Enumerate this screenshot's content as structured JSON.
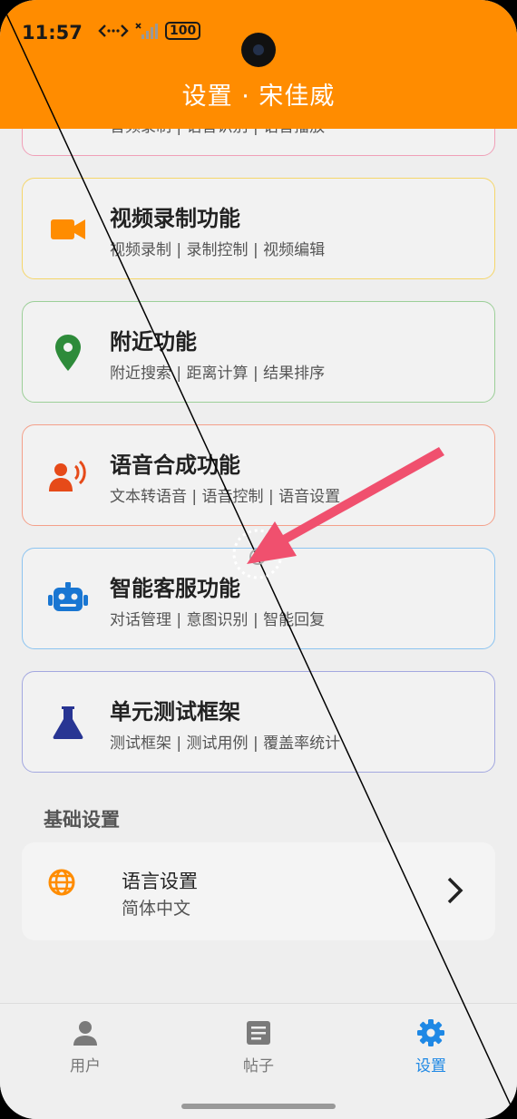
{
  "status": {
    "time": "11:57",
    "battery": "100"
  },
  "header": {
    "title": "设置 · 宋佳威"
  },
  "partial_card": {
    "subtitle": "音频录制 | 语音识别 | 语音播放"
  },
  "cards": [
    {
      "title": "视频录制功能",
      "subtitle": "视频录制 | 录制控制 | 视频编辑",
      "icon": "video-camera-icon",
      "color": "#ff8c00",
      "border": "#f5d66a"
    },
    {
      "title": "附近功能",
      "subtitle": "附近搜索 | 距离计算 | 结果排序",
      "icon": "location-pin-icon",
      "color": "#2e8b3a",
      "border": "#9ccf98"
    },
    {
      "title": "语音合成功能",
      "subtitle": "文本转语音 | 语音控制 | 语音设置",
      "icon": "voice-speaker-icon",
      "color": "#e64a19",
      "border": "#f4a08a"
    },
    {
      "title": "智能客服功能",
      "subtitle": "对话管理 | 意图识别 | 智能回复",
      "icon": "robot-icon",
      "color": "#1976d2",
      "border": "#8cc4f0"
    },
    {
      "title": "单元测试框架",
      "subtitle": "测试框架 | 测试用例 | 覆盖率统计",
      "icon": "flask-icon",
      "color": "#283593",
      "border": "#a3a8e0"
    }
  ],
  "basic_settings": {
    "section_title": "基础设置",
    "language": {
      "title": "语言设置",
      "value": "简体中文",
      "icon": "globe-icon",
      "color": "#ff8c00"
    }
  },
  "nav": [
    {
      "label": "用户",
      "icon": "person-icon",
      "active": false
    },
    {
      "label": "帖子",
      "icon": "article-icon",
      "active": false
    },
    {
      "label": "设置",
      "icon": "gear-icon",
      "active": true
    }
  ],
  "colors": {
    "header": "#ff8c00",
    "active": "#1e88e5",
    "annotation_arrow": "#f0506e"
  }
}
